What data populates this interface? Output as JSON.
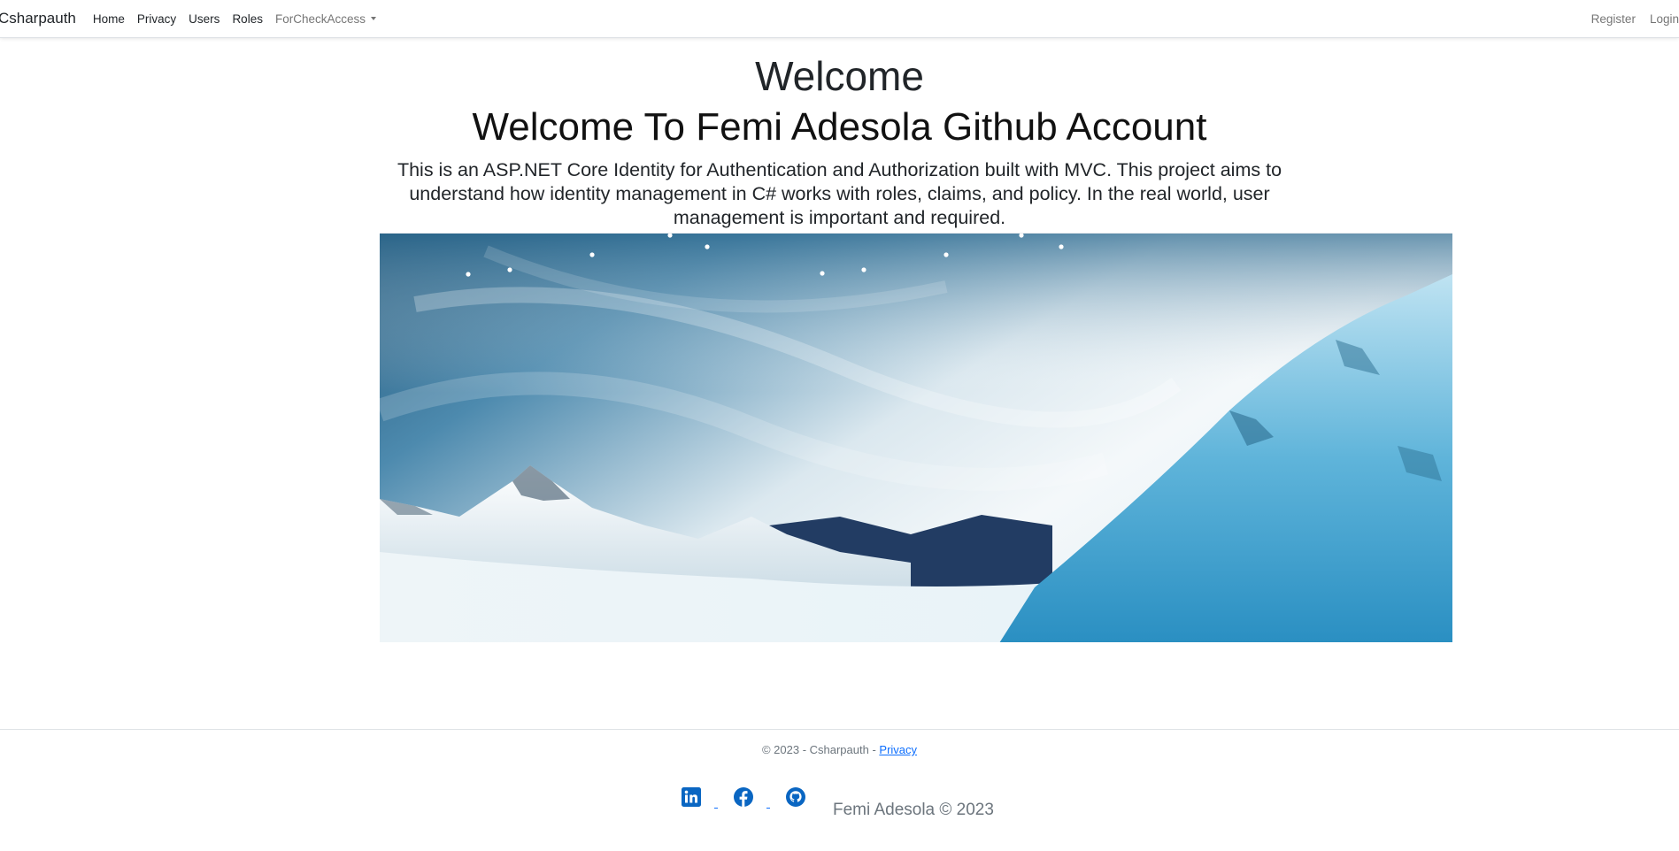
{
  "navbar": {
    "brand": "Csharpauth",
    "links": [
      "Home",
      "Privacy",
      "Users",
      "Roles"
    ],
    "dropdown": "ForCheckAccess",
    "right_links": [
      "Register",
      "Login"
    ]
  },
  "main": {
    "title": "Welcome",
    "subtitle": "Welcome To Femi Adesola Github Account",
    "lead": "This is an ASP.NET Core Identity for Authentication and Authorization built with MVC. This project aims to understand how identity management in C# works with roles, claims, and policy. In the real world, user management is important and required.",
    "hero_image": "snowy-mountains-banner"
  },
  "footer": {
    "copyright": "© 2023 - Csharpauth - ",
    "privacy_link": "Privacy",
    "social": [
      "linkedin-icon",
      "facebook-icon",
      "github-icon"
    ],
    "signature": "Femi Adesola © 2023"
  },
  "colors": {
    "link": "#0d6efd",
    "social": "#0a66c2",
    "muted": "#6c757d"
  }
}
